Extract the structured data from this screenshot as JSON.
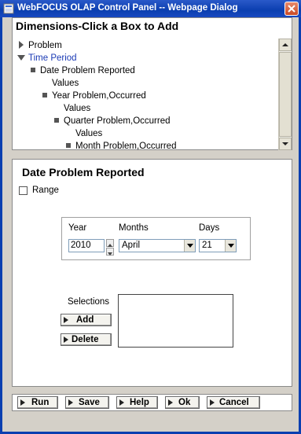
{
  "window": {
    "title": "WebFOCUS OLAP Control Panel -- Webpage Dialog"
  },
  "dimensions": {
    "header": "Dimensions-Click a Box to Add",
    "tree": [
      {
        "label": "Problem",
        "icon": "arrow-right",
        "collapsed": true
      },
      {
        "label": "Time Period",
        "icon": "arrow-down",
        "expanded": true,
        "color": "#1a3ab5"
      },
      {
        "label": "Date Problem Reported",
        "icon": "square"
      },
      {
        "label": "Values"
      },
      {
        "label": "Year Problem,Occurred",
        "icon": "square"
      },
      {
        "label": "Values"
      },
      {
        "label": "Quarter Problem,Occurred",
        "icon": "square"
      },
      {
        "label": "Values"
      },
      {
        "label": "Month Problem,Occurred",
        "icon": "square"
      }
    ]
  },
  "panel": {
    "title": "Date Problem Reported",
    "range_label": "Range",
    "range_checked": false,
    "year_label": "Year",
    "months_label": "Months",
    "days_label": "Days",
    "year_value": "2010",
    "month_value": "April",
    "day_value": "21",
    "selections_label": "Selections",
    "selections": [],
    "add_label": "Add",
    "delete_label": "Delete"
  },
  "footer": {
    "run_label": "Run",
    "save_label": "Save",
    "help_label": "Help",
    "ok_label": "Ok",
    "cancel_label": "Cancel"
  }
}
